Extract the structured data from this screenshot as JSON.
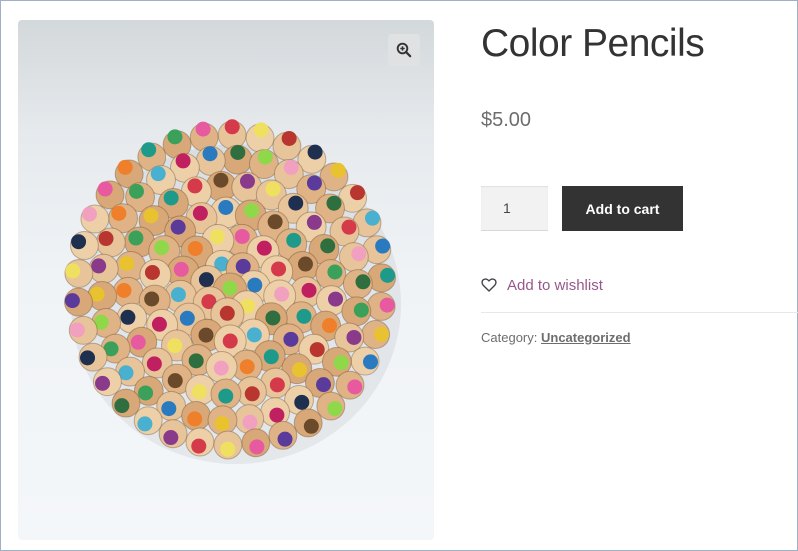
{
  "product": {
    "title": "Color Pencils",
    "price": "$5.00",
    "image_alt": "color pencils bundle, top view"
  },
  "cart": {
    "quantity": "1",
    "add_to_cart_label": "Add to cart"
  },
  "wishlist": {
    "label": "Add to wishlist",
    "icon": "heart-outline-icon"
  },
  "gallery": {
    "zoom_icon": "magnifier-plus-icon"
  },
  "meta": {
    "category_label": "Category:",
    "category_value": "Uncategorized"
  },
  "colors": {
    "wishlist_link": "#96588a",
    "button_bg": "#333333",
    "title": "#333333",
    "muted_text": "#6d6d6d"
  }
}
